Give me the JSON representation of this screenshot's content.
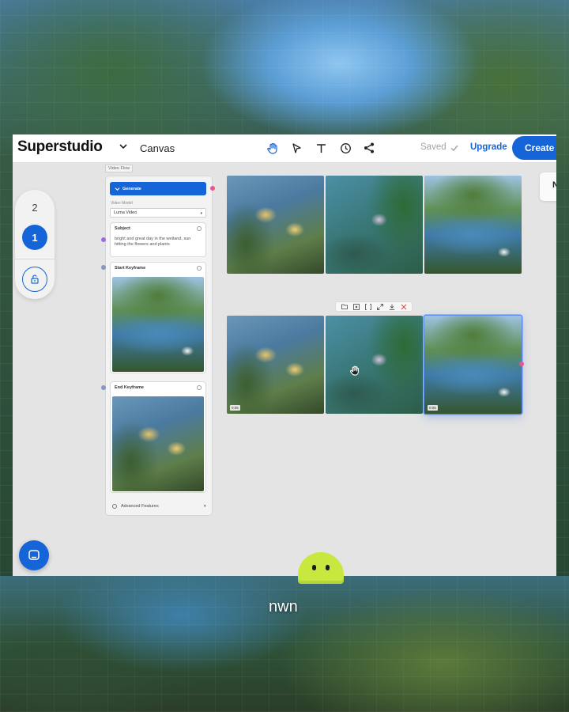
{
  "app": {
    "brand": "Superstudio",
    "page_name": "Canvas",
    "saved_label": "Saved",
    "upgrade_label": "Upgrade",
    "create_label": "Create",
    "edge_tab_label": "N"
  },
  "toolbar": {
    "tools": [
      "hand-icon",
      "pointer-icon",
      "text-icon",
      "clock-icon",
      "share-icon"
    ],
    "active_tool": "hand-icon"
  },
  "pages": {
    "page_two": "2",
    "page_one": "1",
    "current": "1"
  },
  "video_flow": {
    "label": "Video Flow",
    "generate_label": "Generate",
    "model_label": "Video Model",
    "model_value": "Luma Video",
    "subject_title": "Subject",
    "subject_text": "bright and great day in the wetland, sun hitting the flowers and plants",
    "start_keyframe_title": "Start Keyframe",
    "end_keyframe_title": "End Keyframe",
    "advanced_label": "Advanced Features"
  },
  "outputs": {
    "badge_label": "0:05"
  },
  "overlay": {
    "caption": "nwn"
  },
  "colors": {
    "accent": "#1565d8",
    "port_pink": "#e8568a",
    "port_purple": "#9a6be0",
    "delete_red": "#e04545"
  }
}
